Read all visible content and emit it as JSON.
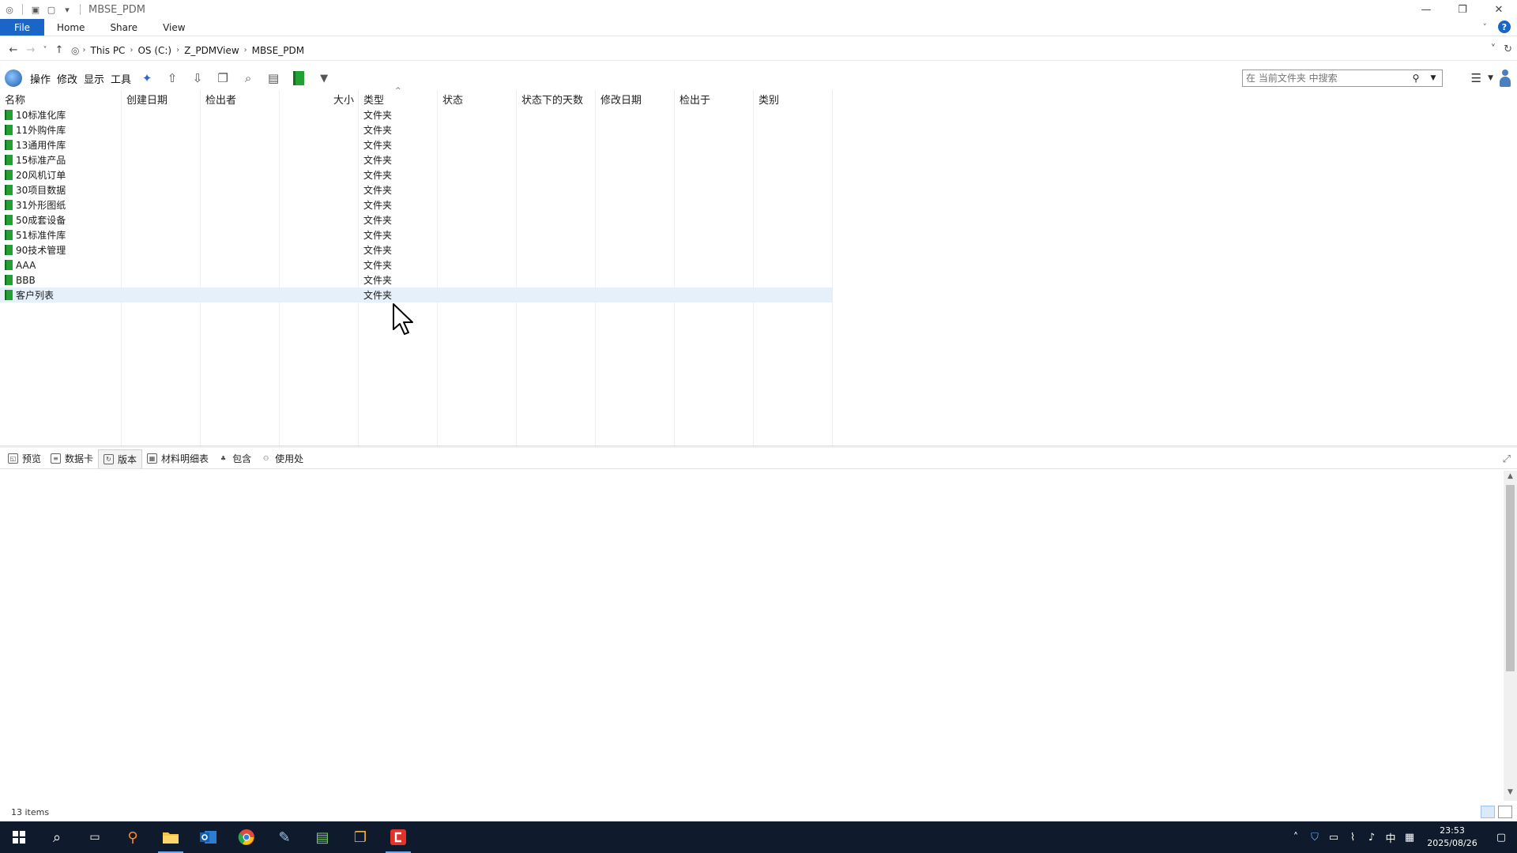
{
  "window": {
    "title": "MBSE_PDM",
    "minimize": "—",
    "restore": "❐",
    "close": "✕"
  },
  "ribbon": {
    "tabs": [
      "File",
      "Home",
      "Share",
      "View"
    ],
    "help": "?"
  },
  "address": {
    "back": "←",
    "forward": "→",
    "recent": "˅",
    "up": "↑",
    "crumbs": [
      "This PC",
      "OS (C:)",
      "Z_PDMView",
      "MBSE_PDM"
    ],
    "refresh": "↻",
    "dropdown": "˅"
  },
  "toolbar": {
    "menus": [
      "操作",
      "修改",
      "显示",
      "工具"
    ],
    "search_placeholder": "在 当前文件夹 中搜索"
  },
  "list": {
    "columns": [
      "名称",
      "创建日期",
      "检出者",
      "大小",
      "类型",
      "状态",
      "状态下的天数",
      "修改日期",
      "检出于",
      "类别"
    ],
    "rows": [
      {
        "name": "10标准化库",
        "type": "文件夹"
      },
      {
        "name": "11外购件库",
        "type": "文件夹"
      },
      {
        "name": "13通用件库",
        "type": "文件夹"
      },
      {
        "name": "15标准产品",
        "type": "文件夹"
      },
      {
        "name": "20风机订单",
        "type": "文件夹"
      },
      {
        "name": "30项目数据",
        "type": "文件夹"
      },
      {
        "name": "31外形图纸",
        "type": "文件夹"
      },
      {
        "name": "50成套设备",
        "type": "文件夹"
      },
      {
        "name": "51标准件库",
        "type": "文件夹"
      },
      {
        "name": "90技术管理",
        "type": "文件夹"
      },
      {
        "name": "AAA",
        "type": "文件夹"
      },
      {
        "name": "BBB",
        "type": "文件夹"
      },
      {
        "name": "客户列表",
        "type": "文件夹"
      }
    ],
    "selected_index": 12
  },
  "panel_tabs": [
    "预览",
    "数据卡",
    "版本",
    "材料明细表",
    "包含",
    "使用处"
  ],
  "active_panel_tab": "版本",
  "status": {
    "item_count": "13 items"
  },
  "clock": {
    "time": "23:53",
    "date": "2025/08/26"
  },
  "tray": {
    "ime": "中"
  }
}
